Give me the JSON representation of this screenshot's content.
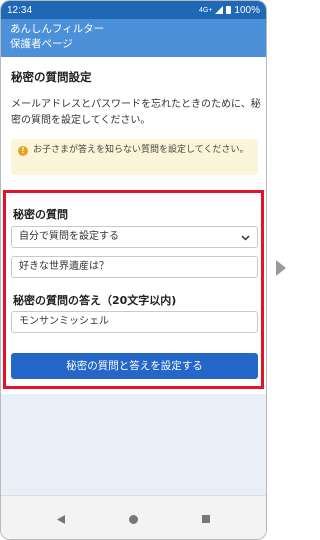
{
  "status_bar": {
    "time": "12:34",
    "network": "4G+",
    "battery": "100%"
  },
  "app_bar": {
    "title_line1": "あんしんフィルター",
    "title_line2": "保護者ページ"
  },
  "section": {
    "title": "秘密の質問設定",
    "description": "メールアドレスとパスワードを忘れたときのために、秘密の質問を設定してください。"
  },
  "notice": {
    "text": "お子さまが答えを知らない質問を設定してください。"
  },
  "form": {
    "question_label": "秘密の質問",
    "question_select_value": "自分で質問を設定する",
    "question_input_value": "好きな世界遺産は？",
    "answer_label": "秘密の質問の答え（20文字以内)",
    "answer_input_value": "モンサンミッシェル",
    "submit_label": "秘密の質問と答えを設定する"
  },
  "icons": {
    "notice": "exclamation-icon",
    "select": "chevron-down-icon",
    "nav_back": "back-triangle-icon",
    "nav_home": "home-circle-icon",
    "nav_recent": "recent-square-icon",
    "next": "next-arrow-icon"
  },
  "colors": {
    "status_bar": "#1e68b5",
    "app_bar": "#4b90d9",
    "highlight_frame": "#e0142a",
    "primary_button": "#2567c8",
    "notice_bg": "#fdf5d9"
  }
}
